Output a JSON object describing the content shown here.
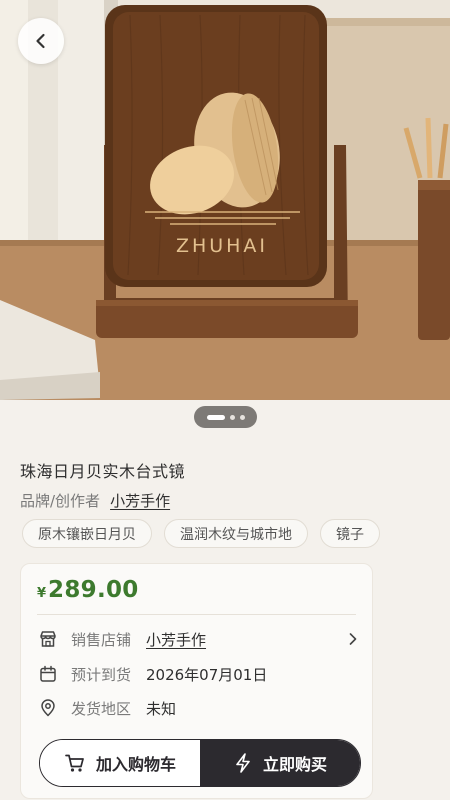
{
  "hero": {
    "engraving_text": "ZHUHAI",
    "pager": {
      "count": 3,
      "active": 0
    }
  },
  "product": {
    "title": "珠海日月贝实木台式镜",
    "brand_label": "品牌/创作者",
    "brand_name": "小芳手作",
    "tags": [
      "原木镶嵌日月贝",
      "温润木纹与城市地",
      "镜子"
    ]
  },
  "card": {
    "currency": "¥",
    "price": "289.00",
    "price_color": "#3d7a2e",
    "store": {
      "icon": "store-icon",
      "label": "销售店铺",
      "value": "小芳手作"
    },
    "delivery": {
      "icon": "calendar-icon",
      "label": "预计到货",
      "value": "2026年07月01日"
    },
    "origin": {
      "icon": "location-pin-icon",
      "label": "发货地区",
      "value": "未知"
    }
  },
  "actions": {
    "cart_label": "加入购物车",
    "buy_label": "立即购买",
    "cart_icon": "shopping-cart-icon",
    "buy_icon": "lightning-icon"
  }
}
